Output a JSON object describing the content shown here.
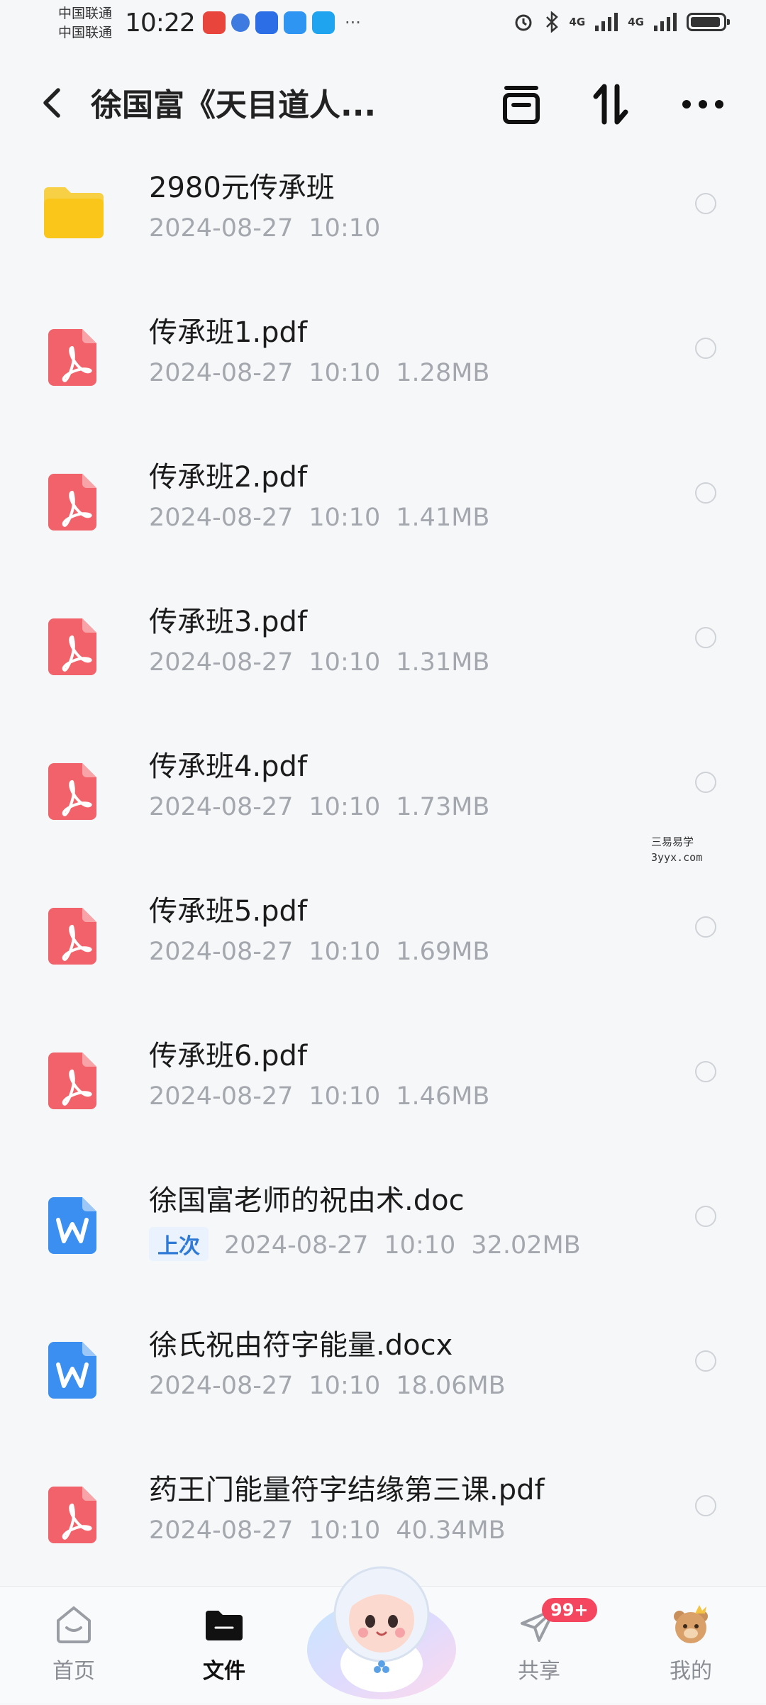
{
  "status_bar": {
    "carrier1": "中国联通",
    "carrier2": "中国联通",
    "time": "10:22",
    "net1": "4G",
    "net2": "4G"
  },
  "header": {
    "title": "徐国富《天目道人..."
  },
  "files": [
    {
      "name": "2980元传承班",
      "date": "2024-08-27",
      "time": "10:10",
      "size": "",
      "type": "folder",
      "tag": ""
    },
    {
      "name": "传承班1.pdf",
      "date": "2024-08-27",
      "time": "10:10",
      "size": "1.28MB",
      "type": "pdf",
      "tag": ""
    },
    {
      "name": "传承班2.pdf",
      "date": "2024-08-27",
      "time": "10:10",
      "size": "1.41MB",
      "type": "pdf",
      "tag": ""
    },
    {
      "name": "传承班3.pdf",
      "date": "2024-08-27",
      "time": "10:10",
      "size": "1.31MB",
      "type": "pdf",
      "tag": ""
    },
    {
      "name": "传承班4.pdf",
      "date": "2024-08-27",
      "time": "10:10",
      "size": "1.73MB",
      "type": "pdf",
      "tag": ""
    },
    {
      "name": "传承班5.pdf",
      "date": "2024-08-27",
      "time": "10:10",
      "size": "1.69MB",
      "type": "pdf",
      "tag": ""
    },
    {
      "name": "传承班6.pdf",
      "date": "2024-08-27",
      "time": "10:10",
      "size": "1.46MB",
      "type": "pdf",
      "tag": ""
    },
    {
      "name": "徐国富老师的祝由术.doc",
      "date": "2024-08-27",
      "time": "10:10",
      "size": "32.02MB",
      "type": "word",
      "tag": "上次"
    },
    {
      "name": "徐氏祝由符字能量.docx",
      "date": "2024-08-27",
      "time": "10:10",
      "size": "18.06MB",
      "type": "word",
      "tag": ""
    },
    {
      "name": "药王门能量符字结缘第三课.pdf",
      "date": "2024-08-27",
      "time": "10:10",
      "size": "40.34MB",
      "type": "pdf",
      "tag": ""
    }
  ],
  "watermark": {
    "line1": "三易易学",
    "line2": "3yyx.com"
  },
  "nav": {
    "home": "首页",
    "files": "文件",
    "share": "共享",
    "share_badge": "99+",
    "mine": "我的"
  },
  "colors": {
    "pdf_icon": "#f2626b",
    "word_icon": "#3a8ff0",
    "folder_icon": "#f9c619",
    "badge": "#f4465f",
    "tag_text": "#2e7ad6"
  }
}
